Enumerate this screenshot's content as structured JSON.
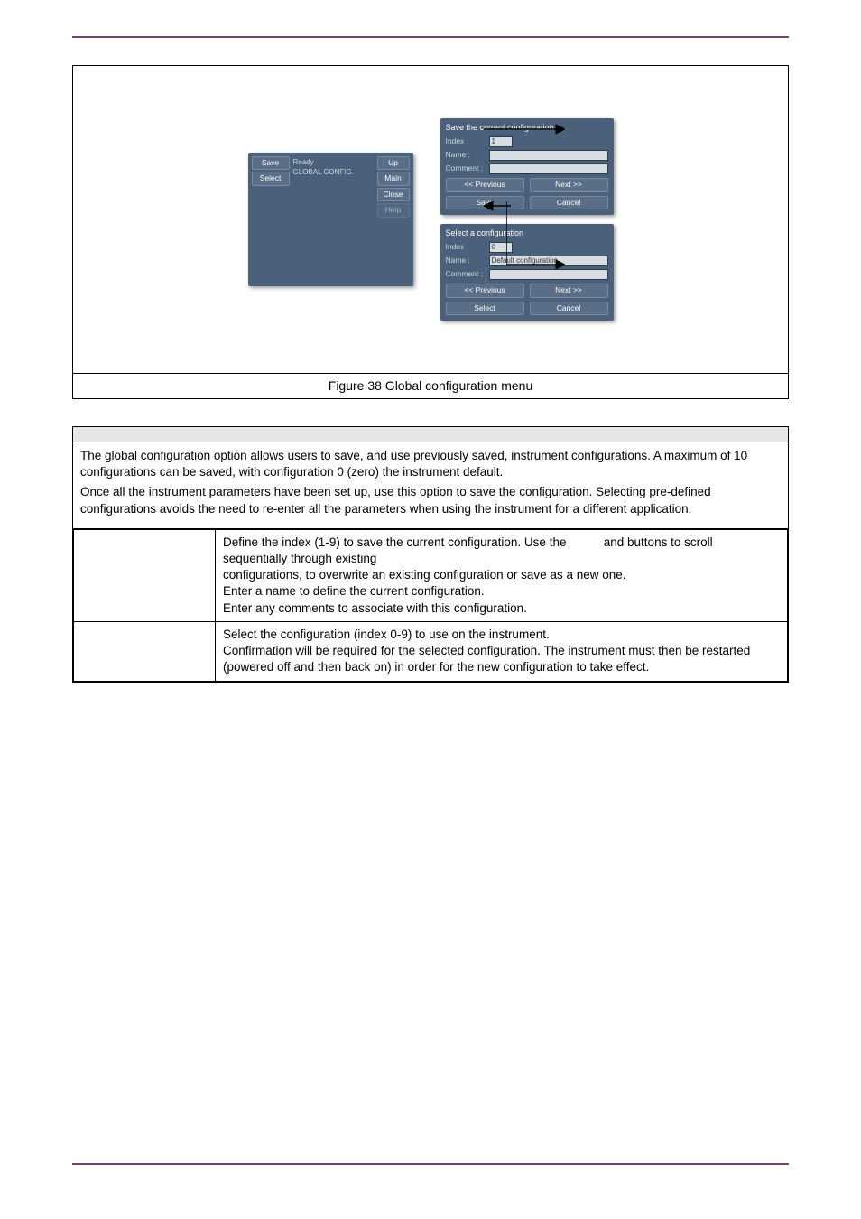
{
  "figure": {
    "caption": "Figure 38  Global configuration menu",
    "labels": {
      "index": "Index",
      "name": "Name :",
      "comment": "Comment :"
    },
    "buttons": {
      "prev": "<< Previous",
      "next": "Next >>",
      "save": "Save",
      "select": "Select",
      "cancel": "Cancel"
    },
    "panelA": {
      "save": "Save",
      "select": "Select",
      "ready": "Ready",
      "breadcrumb": "GLOBAL CONFIG.",
      "up": "Up",
      "main": "Main",
      "close": "Close",
      "help": "Help"
    },
    "panelB": {
      "title": "Save the current configuration",
      "index": "1"
    },
    "panelC": {
      "title": "Select a configuration",
      "index": "0",
      "name": "Default configuration"
    }
  },
  "desc": {
    "p1": "The global configuration option allows users to save, and use previously saved, instrument configurations. A maximum of 10 configurations can be saved, with configuration 0 (zero) the instrument default.",
    "p2": "Once all the instrument parameters have been set up, use this option to save the configuration. Selecting pre-defined configurations avoids the need to re-enter all the parameters when using the instrument for a different application."
  },
  "rows": {
    "r1a": "Define the index (1-9) to save the current configuration. Use the",
    "r1b": "and          buttons to scroll sequentially through existing",
    "r1c": "configurations, to overwrite an existing configuration or save as a new one.",
    "r1d": "Enter a name to define the current configuration.",
    "r1e": "Enter any comments to associate with this configuration.",
    "r2a": "Select the configuration (index 0-9) to use on the instrument.",
    "r2b": "Confirmation will be required for the selected configuration. The instrument must then be restarted (powered off and then back on) in order for the new configuration to take effect."
  }
}
